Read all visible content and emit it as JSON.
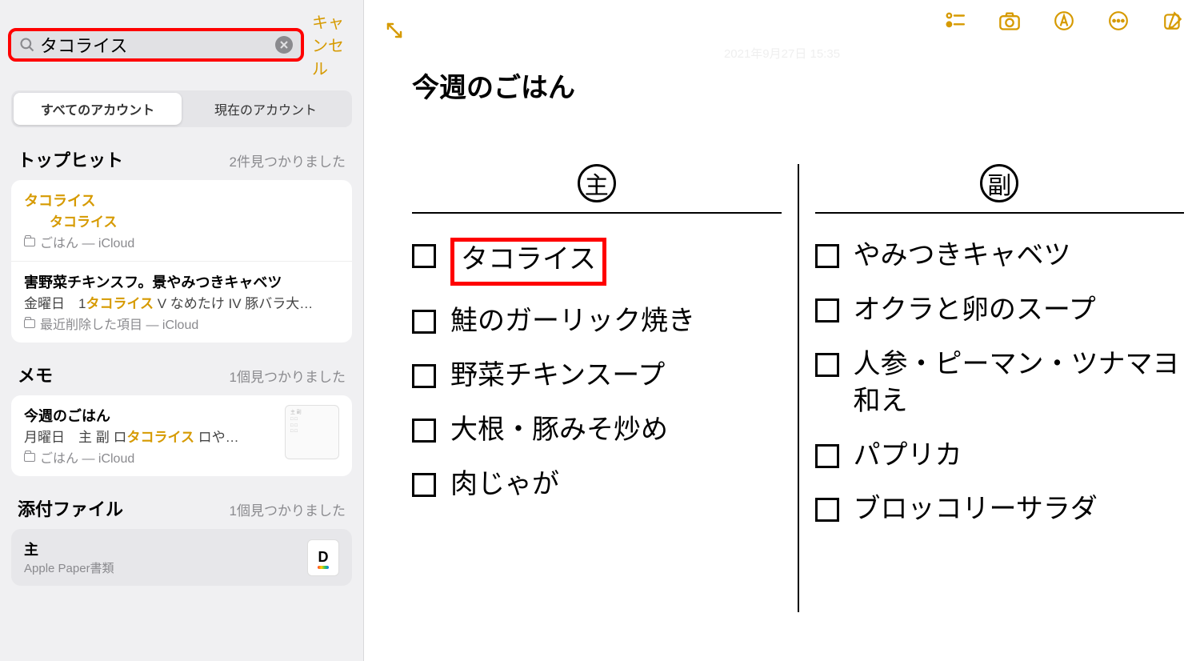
{
  "search": {
    "value": "タコライス",
    "cancel": "キャンセル"
  },
  "segments": {
    "all": "すべてのアカウント",
    "current": "現在のアカウント"
  },
  "sections": {
    "tophit": {
      "title": "トップヒット",
      "count": "2件見つかりました"
    },
    "memo": {
      "title": "メモ",
      "count": "1個見つかりました"
    },
    "attach": {
      "title": "添付ファイル",
      "count": "1個見つかりました"
    }
  },
  "tophits": [
    {
      "title": "タコライス",
      "sub": "タコライス",
      "loc": "ごはん — iCloud"
    },
    {
      "title": "害野菜チキンスフ。景やみつきキャベツ",
      "snippet_pre": "金曜日　1",
      "snippet_hl": "タコライス",
      "snippet_post": " V なめたけ IV 豚バラ大…",
      "loc": "最近削除した項目 — iCloud"
    }
  ],
  "memos": [
    {
      "title": "今週のごはん",
      "snippet_pre": "月曜日　主 副 ロ",
      "snippet_hl": "タコライス",
      "snippet_post": " ロや…",
      "loc": "ごはん — iCloud"
    }
  ],
  "attachments": [
    {
      "title": "主",
      "sub": "Apple Paper書類"
    }
  ],
  "note": {
    "date": "2021年9月27日 15:35",
    "title": "今週のごはん",
    "col1_head": "主",
    "col2_head": "副",
    "col1_items": [
      "タコライス",
      "鮭のガーリック焼き",
      "野菜チキンスープ",
      "大根・豚みそ炒め",
      "肉じゃが"
    ],
    "col2_items": [
      "やみつきキャベツ",
      "オクラと卵のスープ",
      "人参・ピーマン・ツナマヨ和え",
      "パプリカ",
      "ブロッコリーサラダ"
    ]
  }
}
